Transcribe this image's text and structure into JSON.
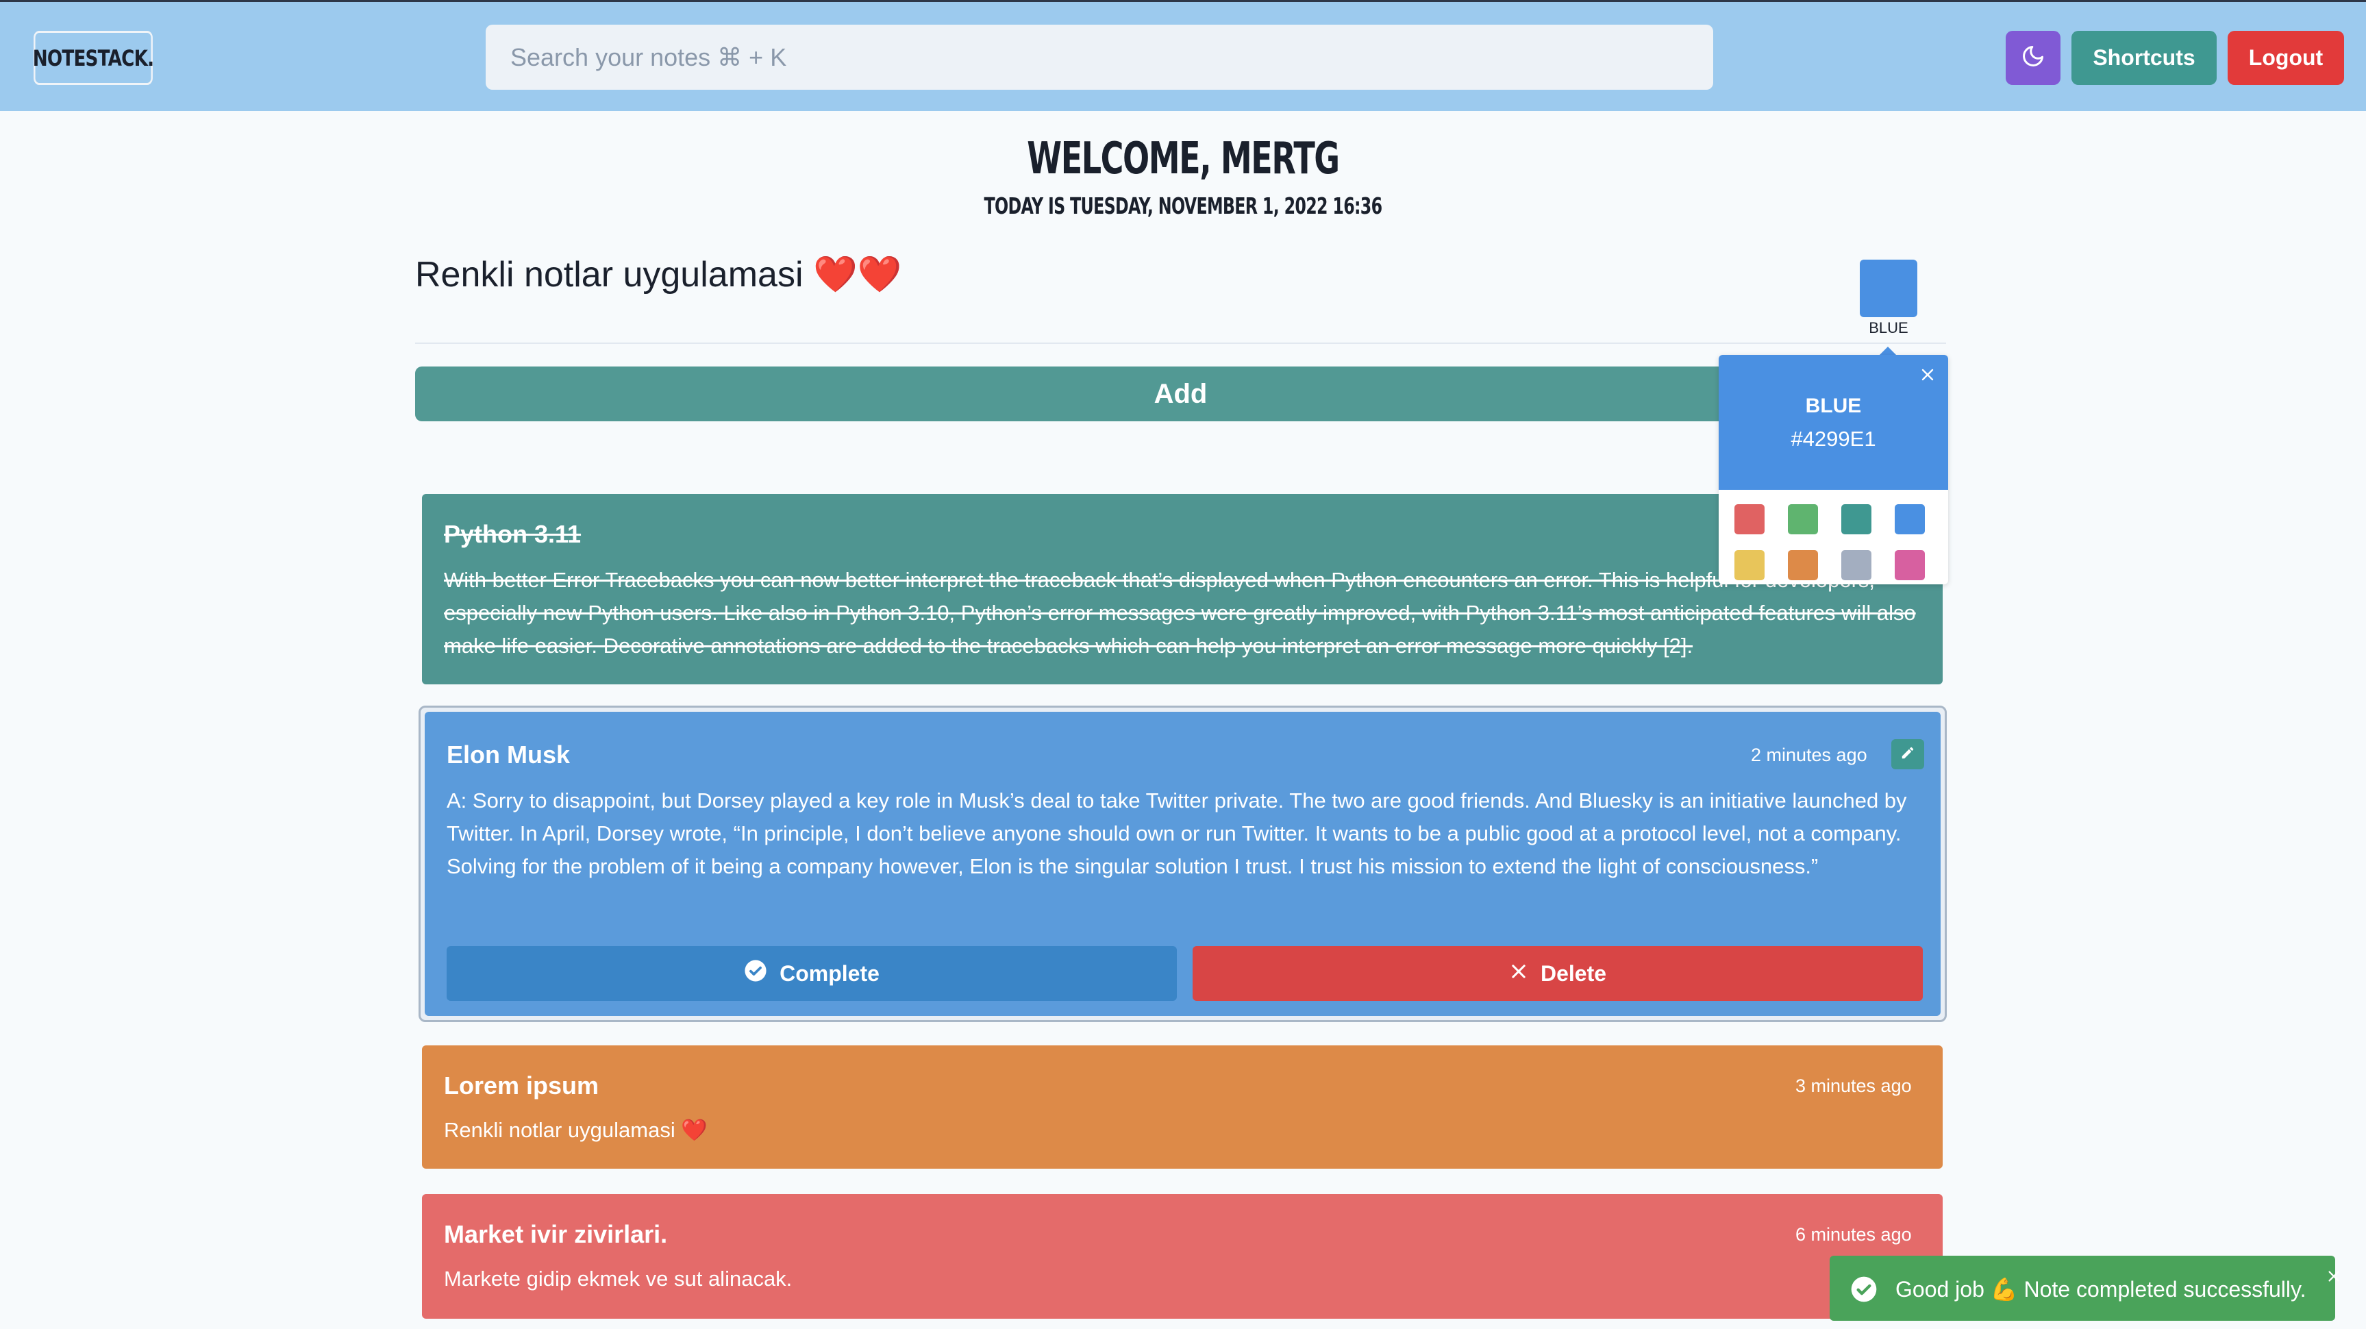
{
  "header": {
    "logo": "NOTESTACK.",
    "search_placeholder": "Search your notes ⌘ + K",
    "theme_icon": "moon-icon",
    "shortcuts_label": "Shortcuts",
    "logout_label": "Logout"
  },
  "welcome": {
    "title": "WELCOME, MERTG",
    "today": "TODAY IS TUESDAY, NOVEMBER 1, 2022 16:36"
  },
  "composer": {
    "input_value": "Renkli notlar uygulamasi ❤️❤️",
    "selected_color_label": "BLUE",
    "add_label": "Add"
  },
  "color_popover": {
    "name": "BLUE",
    "hex": "#4299E1",
    "palette": [
      "#e06262",
      "#5fb46f",
      "#3f9891",
      "#4a90e2",
      "#e8c55a",
      "#dd8a48",
      "#a3aec0",
      "#d760a0"
    ]
  },
  "notes": [
    {
      "title": "Python 3.11",
      "time": "",
      "body": "With better Error Tracebacks you can now better interpret the traceback that’s displayed when Python encounters an error. This is helpful for developers, especially new Python users. Like also in Python 3.10, Python’s error messages were greatly improved, with Python 3.11’s most anticipated features will also make life easier. Decorative annotations are added to the tracebacks which can help you interpret an error message more quickly [2].",
      "completed": true,
      "color": "#4f9591"
    },
    {
      "title": "Elon Musk",
      "time": "2 minutes ago",
      "body": "A: Sorry to disappoint, but Dorsey played a key role in Musk’s deal to take Twitter private. The two are good friends. And Bluesky is an initiative launched by Twitter. In April, Dorsey wrote, “In principle, I don’t believe anyone should own or run Twitter. It wants to be a public good at a protocol level, not a company. Solving for the problem of it being a company however, Elon is the singular solution I trust. I trust his mission to extend the light of consciousness.”",
      "complete_label": "Complete",
      "delete_label": "Delete",
      "color": "#5b9bdb"
    },
    {
      "title": "Lorem ipsum",
      "time": "3 minutes ago",
      "body": "Renkli notlar uygulamasi ❤️",
      "color": "#dd8a48"
    },
    {
      "title": "Market ivir zivirlari.",
      "time": "6 minutes ago",
      "body": "Markete gidip ekmek ve sut alinacak.",
      "color": "#e46b6a"
    }
  ],
  "toast": {
    "message": "Good job 💪 Note completed successfully."
  }
}
